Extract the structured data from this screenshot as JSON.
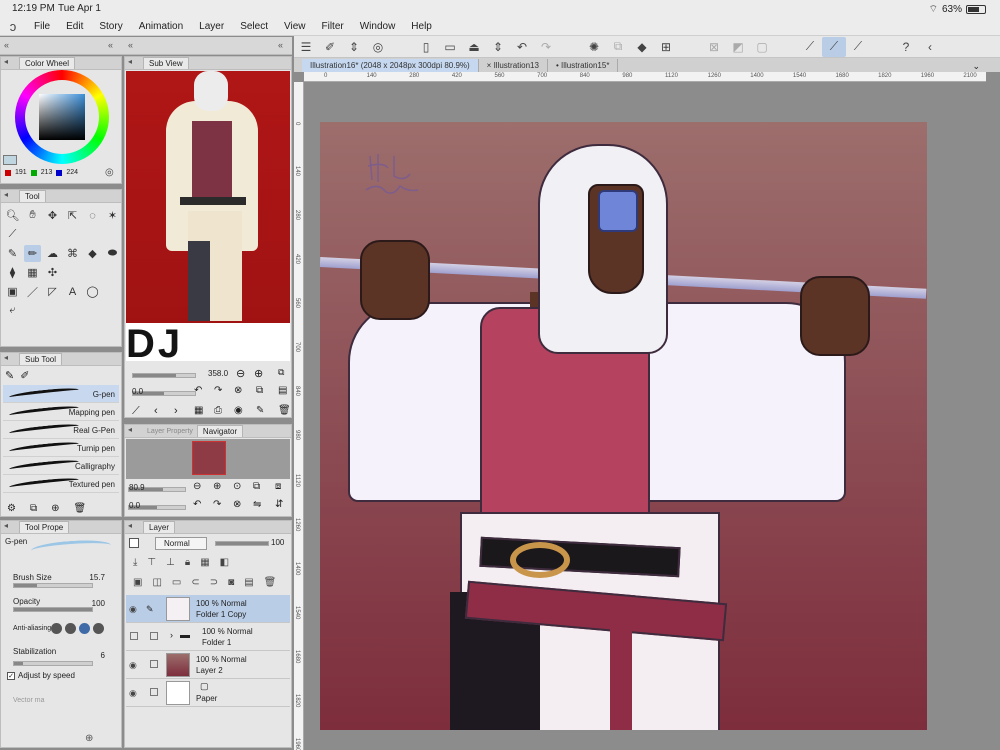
{
  "status": {
    "time": "12:19 PM",
    "date": "Tue Apr 1",
    "battery": "63%"
  },
  "menu": [
    "File",
    "Edit",
    "Story",
    "Animation",
    "Layer",
    "Select",
    "View",
    "Filter",
    "Window",
    "Help"
  ],
  "panels": {
    "color_wheel": {
      "title": "Color Wheel",
      "r": "191",
      "g": "213",
      "b": "224"
    },
    "tool": {
      "title": "Tool"
    },
    "sub_tool": {
      "title": "Sub Tool",
      "brushes": [
        "G-pen",
        "Mapping pen",
        "Real G-Pen",
        "Turnip pen",
        "Calligraphy",
        "Textured pen"
      ]
    },
    "tool_property": {
      "title": "Tool Prope",
      "brush_name": "G-pen",
      "brush_size_label": "Brush Size",
      "brush_size_value": "15.7",
      "opacity_label": "Opacity",
      "opacity_value": "100",
      "antialias_label": "Anti-aliasing",
      "stabilization_label": "Stabilization",
      "stabilization_value": "6",
      "adjust_speed_label": "Adjust by speed",
      "vector_label": "Vector ma"
    },
    "sub_view": {
      "title": "Sub View",
      "zoom": "358.0",
      "rotation": "0.0"
    },
    "navigator": {
      "tab_inactive": "Layer Property",
      "title": "Navigator",
      "zoom": "80.9",
      "rotation": "0.0"
    },
    "layer": {
      "title": "Layer",
      "blend_mode": "Normal",
      "opacity": "100",
      "layers": [
        {
          "pct": "100 %  Normal",
          "name": "Folder 1 Copy",
          "selected": true
        },
        {
          "pct": "100 %  Normal",
          "name": "Folder 1",
          "selected": false
        },
        {
          "pct": "100 %  Normal",
          "name": "Layer 2",
          "selected": false
        },
        {
          "pct": "",
          "name": "Paper",
          "selected": false
        }
      ]
    }
  },
  "tabs": [
    {
      "label": "Illustration16* (2048 x 2048px 300dpi 80.9%)",
      "active": true
    },
    {
      "label": "Illustration13",
      "active": false
    },
    {
      "label": "Illustration15*",
      "active": false
    }
  ],
  "ruler_marks": [
    "0",
    "140",
    "280",
    "420",
    "560",
    "700",
    "840",
    "980",
    "1120",
    "1260",
    "1400",
    "1540",
    "1680",
    "1820",
    "1960",
    "2100"
  ],
  "ruler_left_marks": [
    "0",
    "140",
    "280",
    "420",
    "560",
    "700",
    "840",
    "980",
    "1120",
    "1260",
    "1400",
    "1540",
    "1680",
    "1820",
    "1960"
  ],
  "subview_banner": "DJ",
  "colors": {
    "canvas_top": "#9c6e6c",
    "canvas_bottom": "#7d2d3c",
    "selection": "#b9cde6"
  }
}
